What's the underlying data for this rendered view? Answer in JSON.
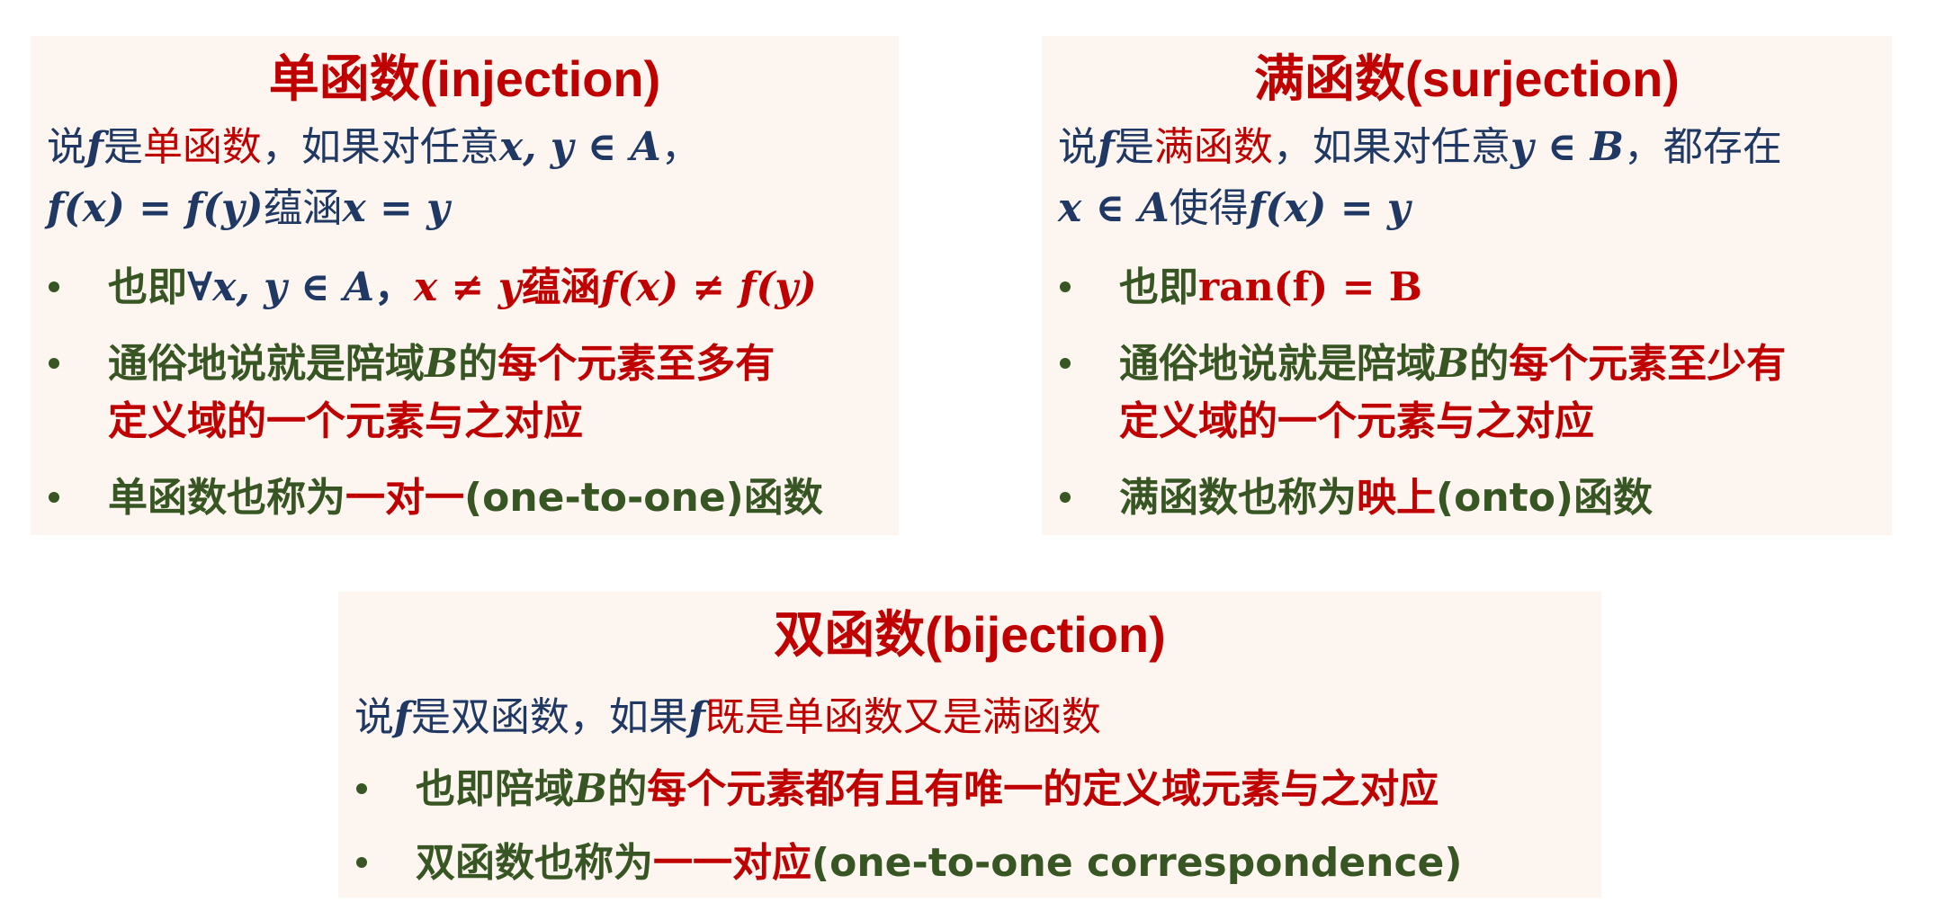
{
  "injection": {
    "title": "单函数(injection)",
    "def1_prefix": "说",
    "def1_f": "f",
    "def1_is": "是",
    "def1_term": "单函数",
    "def1_rest": "，如果对任意",
    "def1_math": "x, y ∈ A",
    "def1_end": "，",
    "def2_math1": "f(x) = f(y)",
    "def2_text": "蕴涵",
    "def2_math2": "x = y",
    "b1_text": "也即",
    "b1_math1": "∀x, y ∈ A",
    "b1_comma": "，",
    "b1_math2": "x ≠ y",
    "b1_imp": "蕴涵",
    "b1_math3": "f(x) ≠ f(y)",
    "b2_text1": "通俗地说就是陪域",
    "b2_B": "B",
    "b2_text2": "的",
    "b2_red1": "每个元素至多有",
    "b2_red2": "定义域的一个元素与之对应",
    "b3_text1": "单函数也称为",
    "b3_red": "一对一",
    "b3_text2": "(one-to-one)函数"
  },
  "surjection": {
    "title": "满函数(surjection)",
    "def1_prefix": "说",
    "def1_f": "f",
    "def1_is": "是",
    "def1_term": "满函数",
    "def1_rest": "，如果对任意",
    "def1_math": "y ∈ B",
    "def1_end": "，都存在",
    "def2_math1": "x ∈ A",
    "def2_text": "使得",
    "def2_math2": "f(x) = y",
    "b1_text": "也即",
    "b1_math": "ran(f) = B",
    "b2_text1": "通俗地说就是陪域",
    "b2_B": "B",
    "b2_text2": "的",
    "b2_red1": "每个元素至少有",
    "b2_red2": "定义域的一个元素与之对应",
    "b3_text1": "满函数也称为",
    "b3_red": "映上",
    "b3_text2": "(onto)函数"
  },
  "bijection": {
    "title": "双函数(bijection)",
    "def_prefix": "说",
    "def_f": "f",
    "def_mid": "是双函数，如果",
    "def_f2": "f",
    "def_red": "既是单函数又是满函数",
    "b1_text1": "也即陪域",
    "b1_B": "B",
    "b1_text2": "的",
    "b1_red": "每个元素都有且有唯一的定义域元素与之对应",
    "b2_text1": "双函数也称为",
    "b2_red": "一一对应",
    "b2_text2": "(one-to-one correspondence)"
  },
  "colors": {
    "title_red": "#c00000",
    "definition_navy": "#1f3864",
    "bullet_green": "#375623",
    "box_background": "#fdf5ef"
  }
}
